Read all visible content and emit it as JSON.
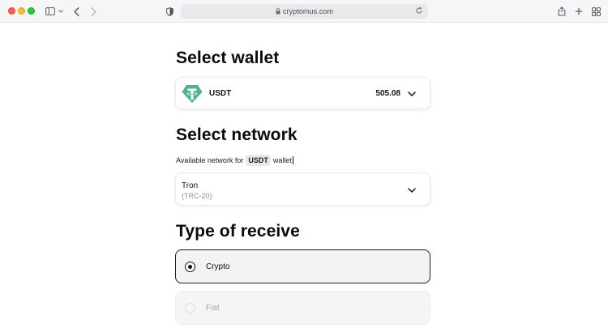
{
  "browser": {
    "url": "cryptomus.com",
    "icons": [
      "close-window-dot",
      "minimize-window-dot",
      "zoom-window-dot",
      "sidebar-icon",
      "chevron-down-icon",
      "back-arrow-icon",
      "forward-arrow-icon",
      "shield-icon",
      "lock-icon",
      "reload-icon",
      "share-icon",
      "new-tab-icon",
      "tab-overview-icon"
    ]
  },
  "wallet": {
    "title": "Select wallet",
    "currency": "USDT",
    "amount": "505.08",
    "logo_color": "#50af95"
  },
  "network": {
    "title": "Select network",
    "subtitle_prefix": "Available network for",
    "subtitle_currency": "USDT",
    "subtitle_suffix": "wallet",
    "selected_name": "Tron",
    "selected_standard": "(TRC-20)"
  },
  "receive": {
    "title": "Type of receive",
    "options": [
      {
        "label": "Crypto",
        "selected": true
      },
      {
        "label": "Fiat",
        "selected": false,
        "disabled": true
      }
    ]
  }
}
